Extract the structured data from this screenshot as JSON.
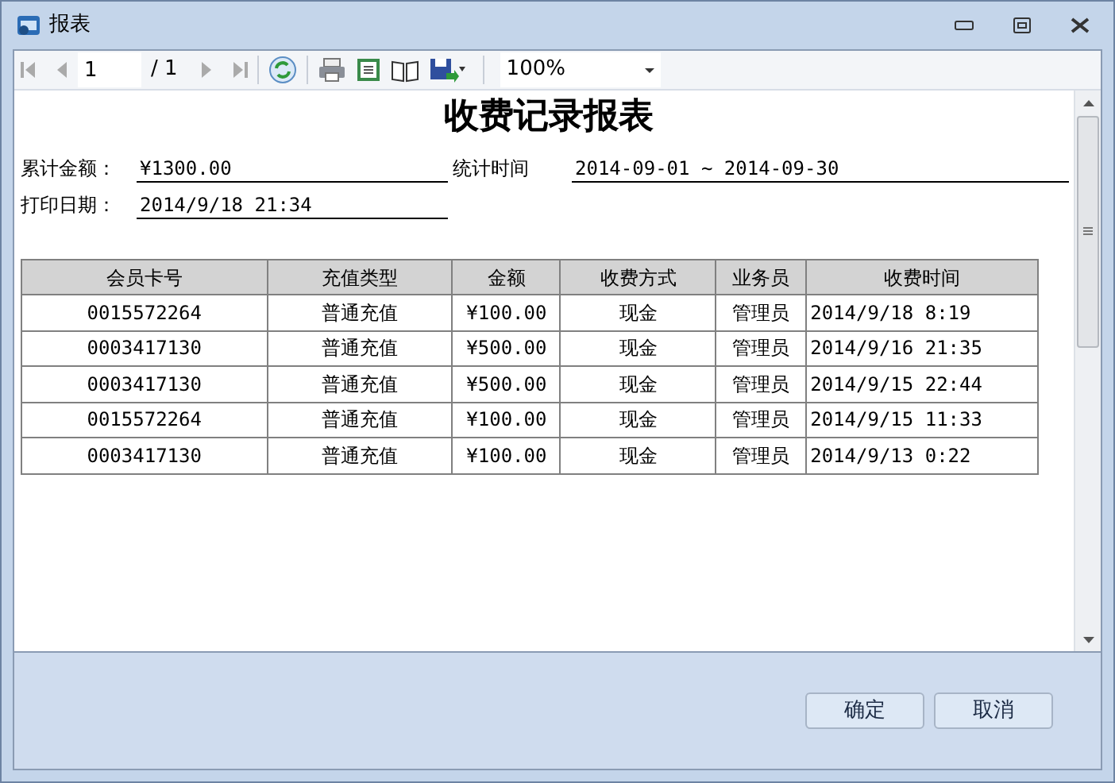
{
  "window": {
    "title": "报表"
  },
  "toolbar": {
    "page": "1",
    "page_count": "/ 1",
    "zoom": "100%"
  },
  "report": {
    "title": "收费记录报表",
    "fields": [
      {
        "label": "累计金额：",
        "value": "¥1300.00"
      },
      {
        "label": "统计时间",
        "value": "2014-09-01 ~ 2014-09-30"
      },
      {
        "label": "打印日期：",
        "value": "2014/9/18 21:34"
      }
    ],
    "table": {
      "columns": [
        "会员卡号",
        "充值类型",
        "金额",
        "收费方式",
        "业务员",
        "收费时间"
      ],
      "rows": [
        [
          "0015572264",
          "普通充值",
          "¥100.00",
          "现金",
          "管理员",
          "2014/9/18 8:19"
        ],
        [
          "0003417130",
          "普通充值",
          "¥500.00",
          "现金",
          "管理员",
          "2014/9/16 21:35"
        ],
        [
          "0003417130",
          "普通充值",
          "¥500.00",
          "现金",
          "管理员",
          "2014/9/15 22:44"
        ],
        [
          "0015572264",
          "普通充值",
          "¥100.00",
          "现金",
          "管理员",
          "2014/9/15 11:33"
        ],
        [
          "0003417130",
          "普通充值",
          "¥100.00",
          "现金",
          "管理员",
          "2014/9/13 0:22"
        ]
      ]
    }
  },
  "buttons": [
    "确定",
    "取消"
  ]
}
